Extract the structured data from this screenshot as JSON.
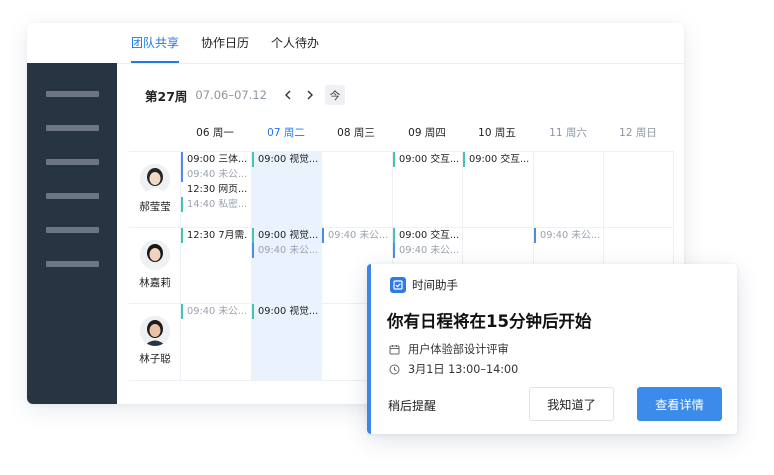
{
  "tabs": [
    {
      "label": "团队共享",
      "active": true
    },
    {
      "label": "协作日历",
      "active": false
    },
    {
      "label": "个人待办",
      "active": false
    }
  ],
  "sidebar": {
    "item_count": 6
  },
  "calendar": {
    "week_title": "第27周",
    "week_range": "07.06–07.12",
    "prev_icon": "chevron-left-icon",
    "next_icon": "chevron-right-icon",
    "today_label": "今",
    "days": [
      {
        "label": "06  周一",
        "state": "normal"
      },
      {
        "label": "07  周二",
        "state": "today"
      },
      {
        "label": "08  周三",
        "state": "normal"
      },
      {
        "label": "09  周四",
        "state": "normal"
      },
      {
        "label": "10  周五",
        "state": "normal"
      },
      {
        "label": "11  周六",
        "state": "weekend"
      },
      {
        "label": "12  周日",
        "state": "weekend"
      }
    ],
    "people": [
      {
        "name": "郝莹莹"
      },
      {
        "name": "林嘉莉"
      },
      {
        "name": "林子聪"
      }
    ],
    "events": [
      {
        "person": 0,
        "day": 0,
        "line": 0,
        "text": "09:00 三体...",
        "style": "dark",
        "bar": "blue"
      },
      {
        "person": 0,
        "day": 0,
        "line": 1,
        "text": "09:40 未公...",
        "style": "gray",
        "bar": "blue"
      },
      {
        "person": 0,
        "day": 0,
        "line": 2,
        "text": "12:30 网页...",
        "style": "dark",
        "bar": "none"
      },
      {
        "person": 0,
        "day": 0,
        "line": 3,
        "text": "14:40 私密...",
        "style": "gray",
        "bar": "teal"
      },
      {
        "person": 0,
        "day": 1,
        "line": 0,
        "text": "09:00 视觉...",
        "style": "dark",
        "bar": "teal"
      },
      {
        "person": 0,
        "day": 3,
        "line": 0,
        "text": "09:00 交互...",
        "style": "dark",
        "bar": "teal"
      },
      {
        "person": 0,
        "day": 4,
        "line": 0,
        "text": "09:00 交互...",
        "style": "dark",
        "bar": "teal"
      },
      {
        "person": 1,
        "day": 0,
        "line": 0,
        "text": "12:30 7月需...",
        "style": "dark",
        "bar": "teal"
      },
      {
        "person": 1,
        "day": 1,
        "line": 0,
        "text": "09:00 视觉...",
        "style": "dark",
        "bar": "teal"
      },
      {
        "person": 1,
        "day": 1,
        "line": 1,
        "text": "09:40 未公...",
        "style": "gray",
        "bar": "blue"
      },
      {
        "person": 1,
        "day": 2,
        "line": 0,
        "text": "09:40 未公...",
        "style": "gray",
        "bar": "blue"
      },
      {
        "person": 1,
        "day": 3,
        "line": 0,
        "text": "09:00 交互...",
        "style": "dark",
        "bar": "teal"
      },
      {
        "person": 1,
        "day": 3,
        "line": 1,
        "text": "09:40 未公...",
        "style": "gray",
        "bar": "blue"
      },
      {
        "person": 1,
        "day": 5,
        "line": 0,
        "text": "09:40 未公...",
        "style": "gray",
        "bar": "blue"
      },
      {
        "person": 2,
        "day": 0,
        "line": 0,
        "text": "09:40 未公...",
        "style": "gray",
        "bar": "teal"
      },
      {
        "person": 2,
        "day": 1,
        "line": 0,
        "text": "09:00 视觉...",
        "style": "dark",
        "bar": "teal"
      }
    ]
  },
  "popup": {
    "app_name": "时间助手",
    "title": "你有日程将在15分钟后开始",
    "event_name": "用户体验部设计评审",
    "event_time": "3月1日 13:00–14:00",
    "later_label": "稍后提醒",
    "ok_label": "我知道了",
    "detail_label": "查看详情",
    "accent_color": "#3b86e6"
  },
  "colors": {
    "active_tab": "#1e78e6",
    "sidebar_bg": "#273442",
    "today_column": "#eaf3fd",
    "bar_blue": "#4a8de8",
    "bar_teal": "#48c2b5",
    "weekend_text": "#8b95a1"
  }
}
